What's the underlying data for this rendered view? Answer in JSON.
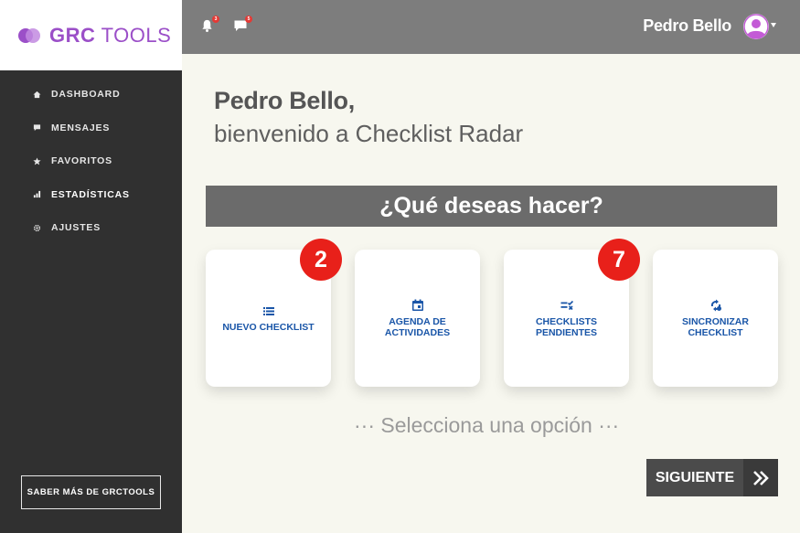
{
  "brand": {
    "logo_bold": "GRC",
    "logo_rest": " TOOLS",
    "color": "#9b4fc8"
  },
  "sidebar": {
    "items": [
      {
        "label": "DASHBOARD",
        "icon": "home-icon"
      },
      {
        "label": "MENSAJES",
        "icon": "message-icon"
      },
      {
        "label": "FAVORITOS",
        "icon": "star-icon"
      },
      {
        "label": "ESTADÍSTICAS",
        "icon": "bar-chart-icon",
        "active": true
      },
      {
        "label": "AJUSTES",
        "icon": "gear-icon"
      }
    ],
    "saber_mas": "SABER MÁS DE GRCTOOLS"
  },
  "header": {
    "notifications_badge": "3",
    "messages_badge": "5",
    "user_name": "Pedro Bello"
  },
  "main": {
    "greeting_name": "Pedro Bello,",
    "greeting_text": "bienvenido a Checklist Radar",
    "question": "¿Qué deseas hacer?",
    "cards": [
      {
        "label": "NUEVO CHECKLIST",
        "icon": "list-icon",
        "badge": "2"
      },
      {
        "label": "AGENDA DE ACTIVIDADES",
        "icon": "calendar-icon"
      },
      {
        "label": "CHECKLISTS PENDIENTES",
        "icon": "checklist-pending-icon",
        "badge": "7"
      },
      {
        "label": "SINCRONIZAR CHECKLIST",
        "icon": "sync-icon"
      }
    ],
    "hint": "··· Selecciona una opción ···",
    "next_label": "SIGUIENTE"
  },
  "colors": {
    "accent_blue": "#1a56a8",
    "badge_red": "#e8201a",
    "header_gray": "#7d7d7d",
    "sidebar_dark": "#303030"
  }
}
